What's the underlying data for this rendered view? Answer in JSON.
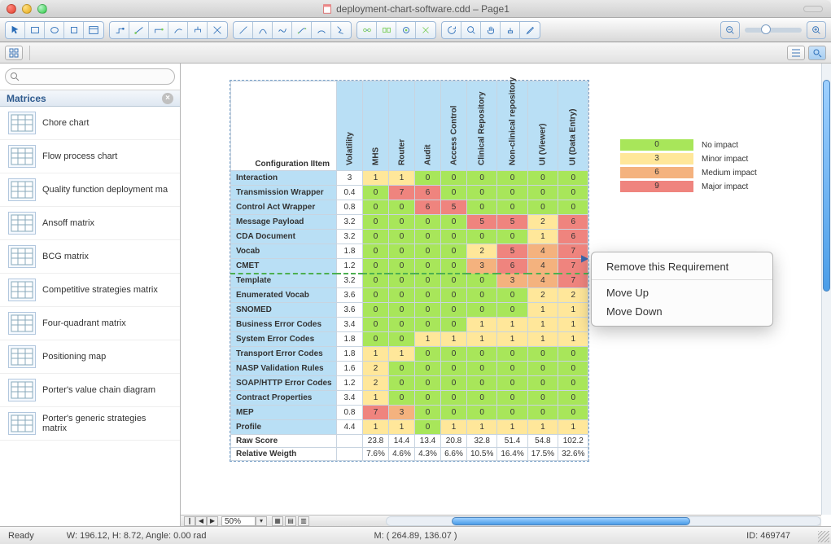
{
  "window": {
    "title": "deployment-chart-software.cdd – Page1"
  },
  "search": {
    "placeholder": ""
  },
  "sidebar": {
    "header": "Matrices",
    "items": [
      "Chore chart",
      "Flow process chart",
      "Quality function deployment ma",
      "Ansoff matrix",
      "BCG matrix",
      "Competitive strategies matrix",
      "Four-quadrant matrix",
      "Positioning map",
      "Porter's value chain diagram",
      "Porter's generic strategies matrix"
    ]
  },
  "chart_data": {
    "type": "heatmap",
    "title": "Configuration IItem",
    "columns": [
      "Volatility",
      "MHS",
      "Router",
      "Audit",
      "Access Control",
      "Clinical Repository",
      "Non-clinical repository",
      "UI (Viewer)",
      "UI (Data Entry)"
    ],
    "rows": [
      {
        "name": "Interaction",
        "vol": 3,
        "cells": [
          1,
          1,
          0,
          0,
          0,
          0,
          0,
          0
        ]
      },
      {
        "name": "Transmission Wrapper",
        "vol": 0.4,
        "cells": [
          0,
          7,
          6,
          0,
          0,
          0,
          0,
          0
        ]
      },
      {
        "name": "Control Act Wrapper",
        "vol": 0.8,
        "cells": [
          0,
          0,
          6,
          5,
          0,
          0,
          0,
          0
        ]
      },
      {
        "name": "Message Payload",
        "vol": 3.2,
        "cells": [
          0,
          0,
          0,
          0,
          5,
          5,
          2,
          6
        ]
      },
      {
        "name": "CDA Document",
        "vol": 3.2,
        "cells": [
          0,
          0,
          0,
          0,
          0,
          0,
          1,
          6
        ]
      },
      {
        "name": "Vocab",
        "vol": 1.8,
        "cells": [
          0,
          0,
          0,
          0,
          2,
          5,
          4,
          7
        ]
      },
      {
        "name": "CMET",
        "vol": 1.2,
        "cells": [
          0,
          0,
          0,
          0,
          3,
          6,
          4,
          7
        ]
      },
      {
        "name": "Template",
        "vol": 3.2,
        "cells": [
          0,
          0,
          0,
          0,
          0,
          3,
          4,
          7
        ]
      },
      {
        "name": "Enumerated Vocab",
        "vol": 3.6,
        "cells": [
          0,
          0,
          0,
          0,
          0,
          0,
          2,
          2
        ]
      },
      {
        "name": "SNOMED",
        "vol": 3.6,
        "cells": [
          0,
          0,
          0,
          0,
          0,
          0,
          1,
          1
        ]
      },
      {
        "name": "Business Error Codes",
        "vol": 3.4,
        "cells": [
          0,
          0,
          0,
          0,
          1,
          1,
          1,
          1
        ]
      },
      {
        "name": "System Error Codes",
        "vol": 1.8,
        "cells": [
          0,
          0,
          1,
          1,
          1,
          1,
          1,
          1
        ]
      },
      {
        "name": "Transport Error Codes",
        "vol": 1.8,
        "cells": [
          1,
          1,
          0,
          0,
          0,
          0,
          0,
          0
        ]
      },
      {
        "name": "NASP Validation Rules",
        "vol": 1.6,
        "cells": [
          2,
          0,
          0,
          0,
          0,
          0,
          0,
          0
        ]
      },
      {
        "name": "SOAP/HTTP Error Codes",
        "vol": 1.2,
        "cells": [
          2,
          0,
          0,
          0,
          0,
          0,
          0,
          0
        ]
      },
      {
        "name": "Contract Properties",
        "vol": 3.4,
        "cells": [
          1,
          0,
          0,
          0,
          0,
          0,
          0,
          0
        ]
      },
      {
        "name": "MEP",
        "vol": 0.8,
        "cells": [
          7,
          3,
          0,
          0,
          0,
          0,
          0,
          0
        ]
      },
      {
        "name": "Profile",
        "vol": 4.4,
        "cells": [
          1,
          1,
          0,
          1,
          1,
          1,
          1,
          1
        ]
      }
    ],
    "footers": [
      {
        "name": "Raw Score",
        "cells": [
          "23.8",
          "14.4",
          "13.4",
          "20.8",
          "32.8",
          "51.4",
          "54.8",
          "102.2"
        ]
      },
      {
        "name": "Relative Weigth",
        "cells": [
          "7.6%",
          "4.6%",
          "4.3%",
          "6.6%",
          "10.5%",
          "16.4%",
          "17.5%",
          "32.6%"
        ]
      }
    ],
    "dashed_row_index": 7
  },
  "legend": {
    "rows": [
      {
        "val": "0",
        "label": "No impact",
        "color": "#a8e65a"
      },
      {
        "val": "3",
        "label": "Minor impact",
        "color": "#ffe79a"
      },
      {
        "val": "6",
        "label": "Medium impact",
        "color": "#f4b27e"
      },
      {
        "val": "9",
        "label": "Major impact",
        "color": "#ef847e"
      }
    ]
  },
  "context": {
    "items": [
      "Remove this Requirement",
      "Move Up",
      "Move Down"
    ]
  },
  "zoom": {
    "pct": "50%"
  },
  "status": {
    "ready": "Ready",
    "dims": "W: 196.12,  H: 8.72,  Angle: 0.00 rad",
    "mouse": "M: ( 264.89, 136.07 )",
    "id": "ID: 469747"
  },
  "color_scale": {
    "0": "#a8e65a",
    "1": "#ffe79a",
    "2": "#ffe79a",
    "3": "#f4b27e",
    "4": "#f4b27e",
    "5": "#ef847e",
    "6": "#ef847e",
    "7": "#ef847e",
    "8": "#ef847e",
    "9": "#ef847e"
  }
}
